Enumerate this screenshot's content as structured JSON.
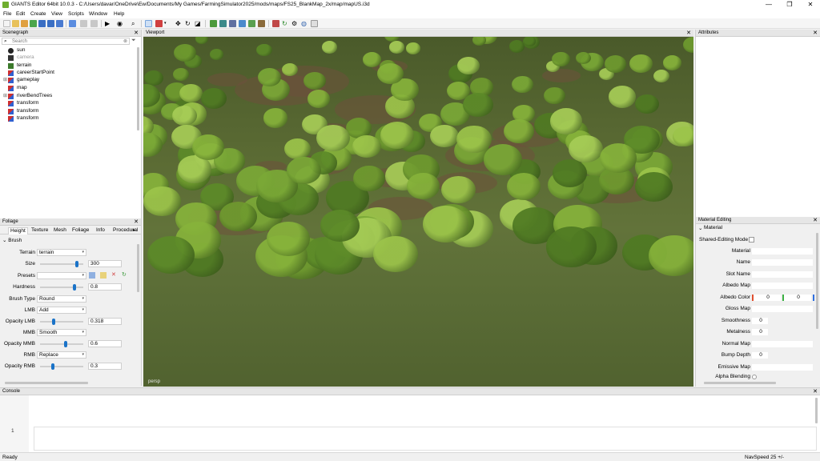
{
  "window": {
    "title": "GIANTS Editor 64bit 10.0.3 - C:/Users/davar/OneDrive\\Ew/Documents/My Games/FarmingSimulator2025/mods/maps/FS25_BlankMap_2x/map/mapUS.i3d",
    "minimize": "—",
    "maximize": "❐",
    "close": "✕"
  },
  "menu": [
    "File",
    "Edit",
    "Create",
    "View",
    "Scripts",
    "Window",
    "Help"
  ],
  "scenegraph": {
    "title": "Scenegraph",
    "search_placeholder": "Search",
    "items": [
      {
        "label": "sun",
        "icon": "light-icon"
      },
      {
        "label": "camera",
        "icon": "camera-icon"
      },
      {
        "label": "terrain",
        "icon": "terrain-icon"
      },
      {
        "label": "careerStartPoint",
        "icon": "transform-icon"
      },
      {
        "label": "gameplay",
        "icon": "transform-icon",
        "expandable": true
      },
      {
        "label": "map",
        "icon": "transform-icon"
      },
      {
        "label": "riverBendTrees",
        "icon": "transform-icon",
        "expandable": true
      },
      {
        "label": "transform",
        "icon": "transform-icon"
      },
      {
        "label": "transform",
        "icon": "transform-icon"
      },
      {
        "label": "transform",
        "icon": "transform-icon"
      }
    ]
  },
  "foliage": {
    "title": "Foliage",
    "tabs": [
      "Height",
      "Texture",
      "Mesh",
      "Foliage",
      "Info",
      "Procedural"
    ],
    "active_tab": "Height",
    "section": "Brush",
    "terrain_label": "Terrain",
    "terrain_value": "terrain",
    "size_label": "Size",
    "size_value": "300",
    "size_fraction": 0.85,
    "presets_label": "Presets",
    "hardness_label": "Hardness",
    "hardness_value": "0.8",
    "hardness_fraction": 0.8,
    "brush_type_label": "Brush Type",
    "brush_type_value": "Round",
    "lmb_label": "LMB",
    "lmb_value": "Add",
    "opacity_lmb_label": "Opacity LMB",
    "opacity_lmb_value": "0.318",
    "opacity_lmb_fraction": 0.318,
    "mmb_label": "MMB",
    "mmb_value": "Smooth",
    "opacity_mmb_label": "Opacity MMB",
    "opacity_mmb_value": "0.6",
    "opacity_mmb_fraction": 0.6,
    "rmb_label": "RMB",
    "rmb_value": "Replace",
    "opacity_rmb_label": "Opacity RMB",
    "opacity_rmb_value": "0.3",
    "opacity_rmb_fraction": 0.3
  },
  "viewport": {
    "title": "Viewport",
    "camera_label": "persp"
  },
  "attributes": {
    "title": "Attributes"
  },
  "material_editing": {
    "title": "Material Editing",
    "section": "Material",
    "shared_editing_label": "Shared-Editing Mode",
    "rows": {
      "material": "Material",
      "name": "Name",
      "slot_name": "Slot Name",
      "albedo_map": "Albedo Map",
      "albedo_color": "Albedo Color",
      "albedo_r": "0",
      "albedo_g": "0",
      "gloss_map": "Gloss Map",
      "smoothness": "Smoothness",
      "smoothness_value": "0",
      "metalness": "Metalness",
      "metalness_value": "0",
      "normal_map": "Normal Map",
      "bump_depth": "Bump Depth",
      "bump_depth_value": "0",
      "emissive_map": "Emissive Map",
      "alpha_blending": "Alpha Blending"
    }
  },
  "console": {
    "title": "Console",
    "line_number": "1"
  },
  "status": {
    "left": "Ready",
    "nav_speed": "NavSpeed 25 +/-"
  },
  "colors": {
    "accent": "#1a73c8",
    "albedo_r": "#e05030",
    "albedo_g": "#3cb043",
    "albedo_b": "#3070e0"
  }
}
